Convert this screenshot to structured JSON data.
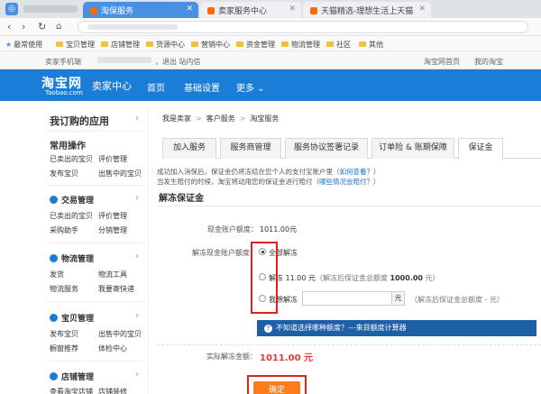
{
  "browser": {
    "tabs": [
      {
        "label": "淘保服务",
        "active": true
      },
      {
        "label": "卖家服务中心",
        "active": false
      },
      {
        "label": "天猫精选-理想生活上天猫",
        "active": false
      }
    ],
    "bookmarks": [
      "最常使用",
      "宝贝管理",
      "店铺管理",
      "货源中心",
      "营销中心",
      "资金管理",
      "物流管理",
      "社区",
      "其他"
    ]
  },
  "infobar": {
    "left": "卖家手机端",
    "mid": "，退出  站内信",
    "right_items": [
      "淘宝网首页",
      "我的淘宝"
    ]
  },
  "header": {
    "brand": "淘宝网",
    "brand_sub": "Taobao.com",
    "center": "卖家中心",
    "nav": [
      "首页",
      "基础设置",
      "更多 ⌄"
    ]
  },
  "sidebar": {
    "title": "我订购的应用",
    "common": {
      "title": "常用操作",
      "links": [
        [
          "已卖出的宝贝",
          "评价管理"
        ],
        [
          "发布宝贝",
          "出售中的宝贝"
        ]
      ]
    },
    "groups": [
      {
        "title": "交易管理",
        "links": [
          [
            "已卖出的宝贝",
            "评价管理"
          ],
          [
            "采购助手",
            "分销管理"
          ]
        ]
      },
      {
        "title": "物流管理",
        "links": [
          [
            "发货",
            "物流工具"
          ],
          [
            "物流服务",
            "我要寄快递"
          ]
        ]
      },
      {
        "title": "宝贝管理",
        "links": [
          [
            "发布宝贝",
            "出售中的宝贝"
          ],
          [
            "橱窗推荐",
            "体检中心"
          ]
        ]
      },
      {
        "title": "店铺管理",
        "links": [
          [
            "查看淘宝店铺",
            "店铺装修"
          ]
        ]
      }
    ]
  },
  "main": {
    "breadcrumb": [
      "我是卖家",
      "客户服务",
      "淘宝服务"
    ],
    "tabs": [
      "加入服务",
      "服务商管理",
      "服务协议签署记录",
      "订单险 & 账期保障",
      "保证金"
    ],
    "active_tab": 4,
    "notice_line1": "成功加入消保后，保证金仍将冻结在您个人的支付宝账户里（",
    "notice_link1": "如何查看？",
    "notice_line1_end": "）",
    "notice_line2": "当发生赔付的时候，淘宝将动用您的保证金进行赔付（",
    "notice_link2": "哪些情况会赔付？",
    "notice_line2_end": "）",
    "section_title": "解冻保证金",
    "balance_label": "现金账户额度：",
    "balance_value": "1011.00元",
    "unfreeze_label": "解冻现金账户额度：",
    "options": [
      {
        "text": "全部解冻",
        "selected": true
      },
      {
        "text": "解冻 11.00 元",
        "note_prefix": "（解冻后保证金总额度 ",
        "note_amount": "1000.00",
        "note_suffix": " 元）",
        "selected": false
      },
      {
        "text": "我想解冻",
        "unit": "元",
        "note": "（解冻后保证金总额度 - 元）",
        "selected": false
      }
    ],
    "amount_input": {
      "value": "",
      "placeholder": ""
    },
    "tip": "不知道选择哪种额度？---来目额度计算器",
    "actual_label": "实际解冻金额：",
    "actual_value": "1011.00 元",
    "confirm": "确定"
  },
  "colors": {
    "header_blue": "#1a7ed8",
    "highlight_red": "#d9241c",
    "confirm_orange": "#ff7a1a",
    "amount_red": "#e4393c"
  }
}
